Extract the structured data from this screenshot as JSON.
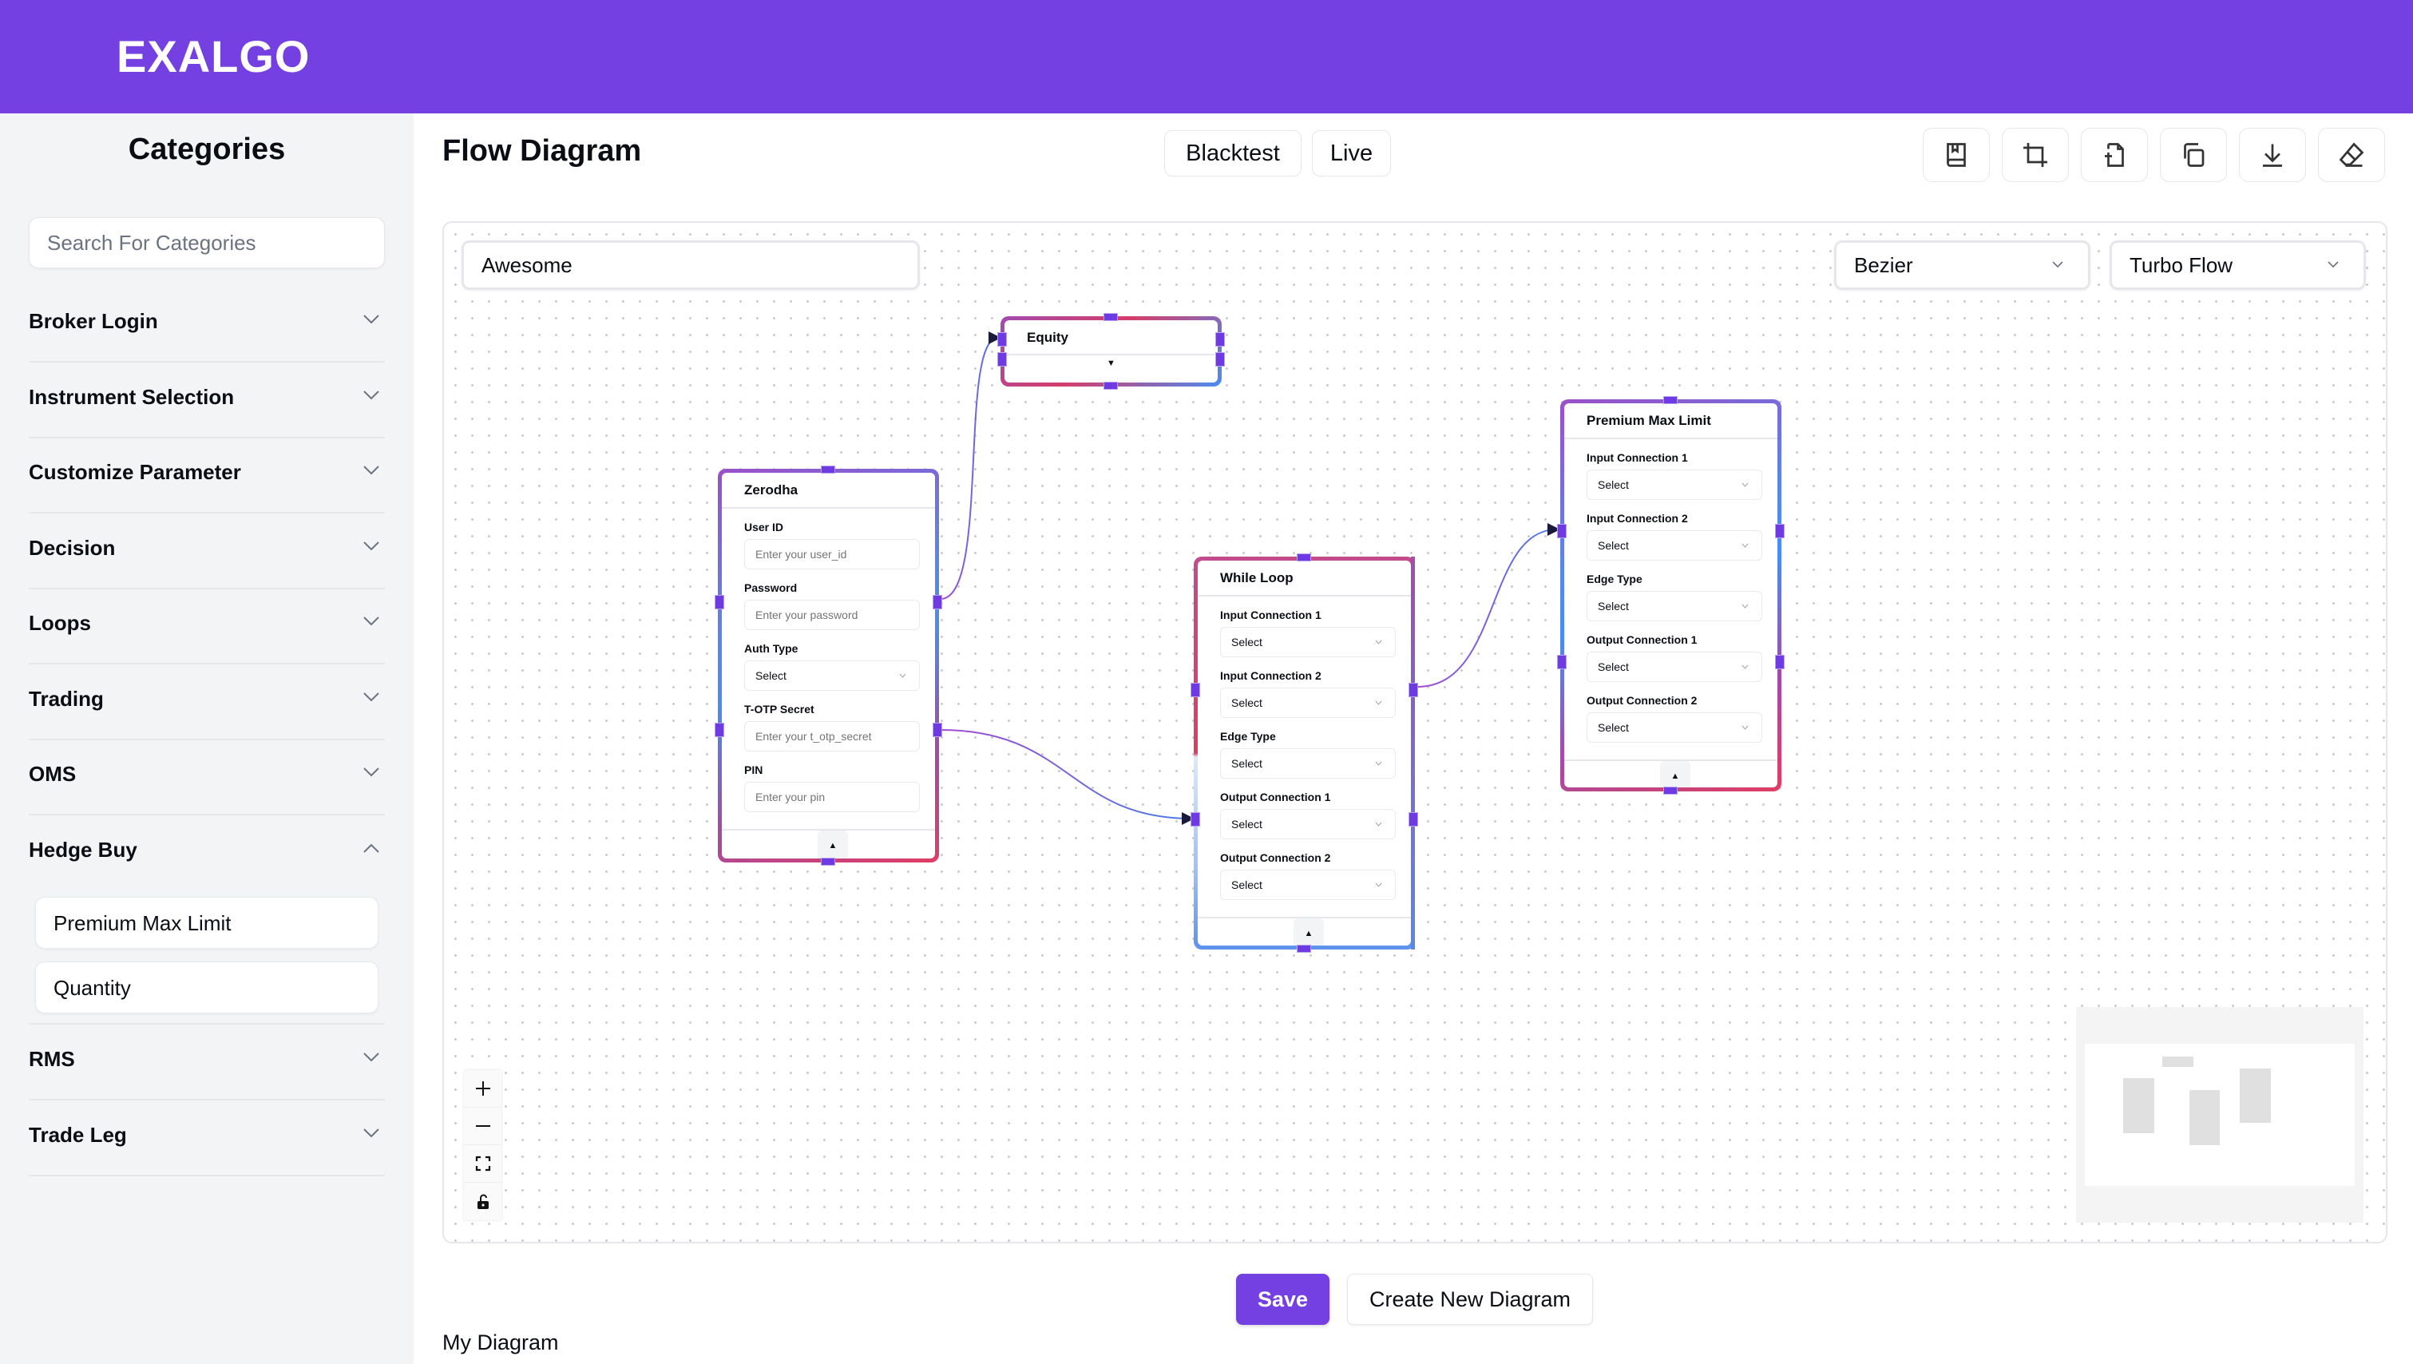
{
  "app": {
    "logo": "EXALGO",
    "accent_color": "#7540e1"
  },
  "sidebar": {
    "title": "Categories",
    "search_placeholder": "Search For Categories",
    "categories": [
      {
        "label": "Broker Login",
        "expanded": false
      },
      {
        "label": "Instrument Selection",
        "expanded": false
      },
      {
        "label": "Customize Parameter",
        "expanded": false
      },
      {
        "label": "Decision",
        "expanded": false
      },
      {
        "label": "Loops",
        "expanded": false
      },
      {
        "label": "Trading",
        "expanded": false
      },
      {
        "label": "OMS",
        "expanded": false
      },
      {
        "label": "Hedge Buy",
        "expanded": true,
        "items": [
          "Premium Max Limit",
          "Quantity"
        ]
      },
      {
        "label": "RMS",
        "expanded": false
      },
      {
        "label": "Trade Leg",
        "expanded": false
      }
    ]
  },
  "main": {
    "title": "Flow Diagram",
    "modes": [
      "Blacktest",
      "Live"
    ],
    "toolbar": [
      {
        "icon": "bookmark-book-icon",
        "label": "Save template"
      },
      {
        "icon": "crop-icon",
        "label": "Crop"
      },
      {
        "icon": "file-plus-icon",
        "label": "New file"
      },
      {
        "icon": "copy-icon",
        "label": "Copy"
      },
      {
        "icon": "download-icon",
        "label": "Download"
      },
      {
        "icon": "eraser-icon",
        "label": "Clear"
      }
    ]
  },
  "canvas": {
    "diagram_name": "Awesome",
    "edge_type": "Bezier",
    "flow_style": "Turbo Flow",
    "nodes": {
      "equity": {
        "title": "Equity",
        "collapsed": true
      },
      "zerodha": {
        "title": "Zerodha",
        "fields": [
          {
            "label": "User ID",
            "type": "input",
            "placeholder": "Enter your user_id"
          },
          {
            "label": "Password",
            "type": "input",
            "placeholder": "Enter your password"
          },
          {
            "label": "Auth Type",
            "type": "select",
            "value": "Select"
          },
          {
            "label": "T-OTP Secret",
            "type": "input",
            "placeholder": "Enter your t_otp_secret"
          },
          {
            "label": "PIN",
            "type": "input",
            "placeholder": "Enter your pin"
          }
        ]
      },
      "while_loop": {
        "title": "While Loop",
        "fields": [
          {
            "label": "Input Connection 1",
            "value": "Select"
          },
          {
            "label": "Input Connection 2",
            "value": "Select"
          },
          {
            "label": "Edge Type",
            "value": "Select"
          },
          {
            "label": "Output Connection 1",
            "value": "Select"
          },
          {
            "label": "Output Connection 2",
            "value": "Select"
          }
        ]
      },
      "premium_max_limit": {
        "title": "Premium Max Limit",
        "fields": [
          {
            "label": "Input Connection 1",
            "value": "Select"
          },
          {
            "label": "Input Connection 2",
            "value": "Select"
          },
          {
            "label": "Edge Type",
            "value": "Select"
          },
          {
            "label": "Output Connection 1",
            "value": "Select"
          },
          {
            "label": "Output Connection 2",
            "value": "Select"
          }
        ]
      }
    },
    "edges": [
      {
        "from": "Zerodha",
        "to": "Equity"
      },
      {
        "from": "Zerodha",
        "to": "While Loop"
      },
      {
        "from": "While Loop",
        "to": "Premium Max Limit"
      }
    ],
    "controls": [
      "zoom-in",
      "zoom-out",
      "fit-view",
      "toggle-lock"
    ]
  },
  "footer": {
    "save_label": "Save",
    "create_label": "Create New Diagram",
    "my_diagram_label": "My Diagram"
  }
}
